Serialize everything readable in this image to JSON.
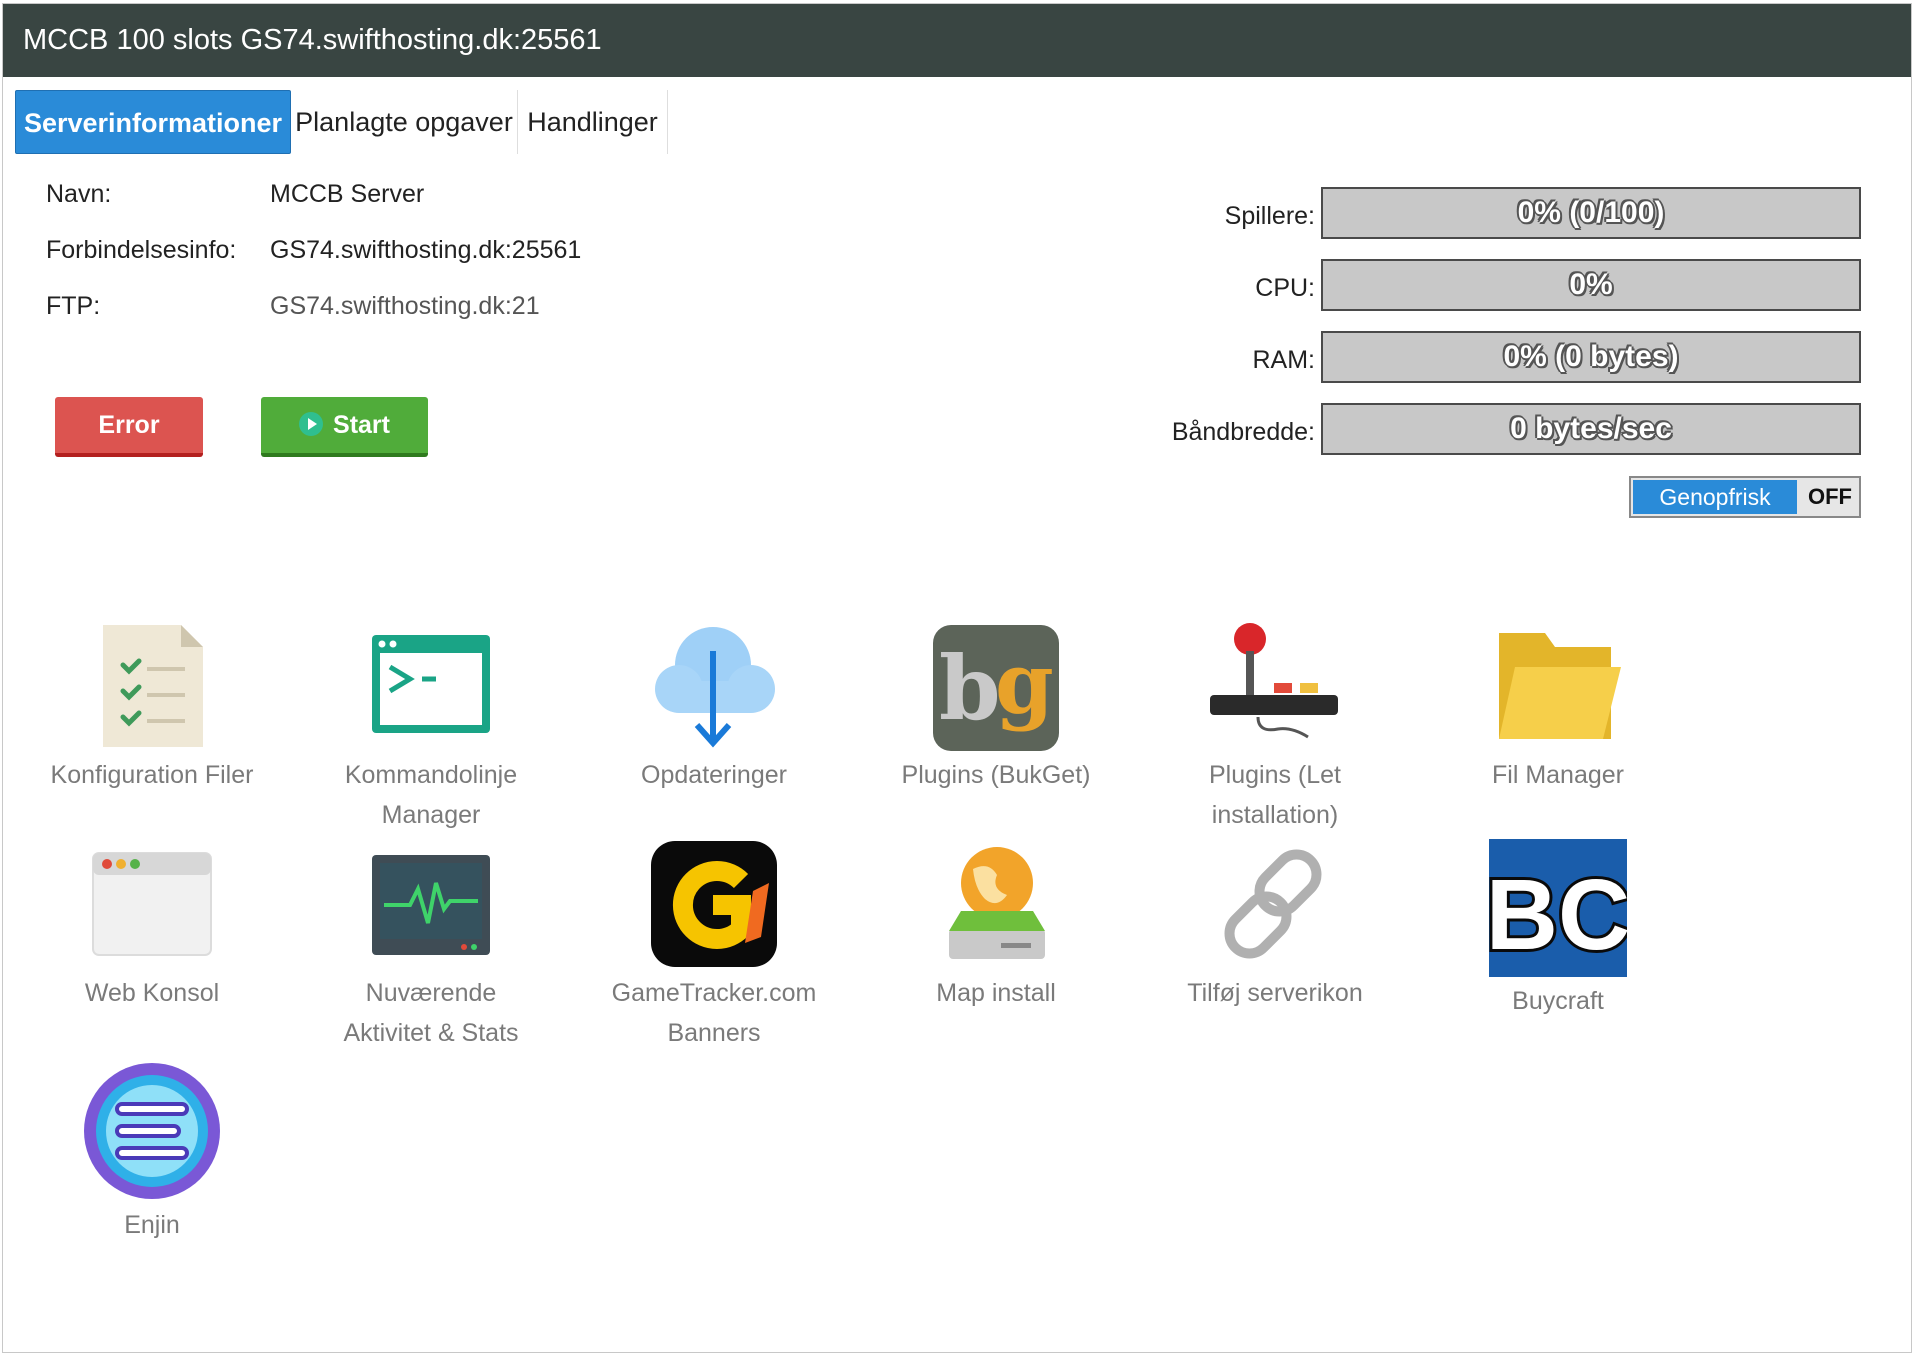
{
  "window": {
    "title": "MCCB 100 slots GS74.swifthosting.dk:25561"
  },
  "tabs": [
    {
      "label": "Serverinformationer",
      "active": true
    },
    {
      "label": "Planlagte opgaver",
      "active": false
    },
    {
      "label": "Handlinger",
      "active": false
    }
  ],
  "info": {
    "name_label": "Navn:",
    "name_value": "MCCB Server",
    "conn_label": "Forbindelsesinfo:",
    "conn_value": "GS74.swifthosting.dk:25561",
    "ftp_label": "FTP:",
    "ftp_value": "GS74.swifthosting.dk:21"
  },
  "buttons": {
    "error": "Error",
    "start": "Start"
  },
  "stats": {
    "players_label": "Spillere:",
    "players_text": "0% (0/100)",
    "players_fraction": 0,
    "cpu_label": "CPU:",
    "cpu_text": "0%",
    "cpu_fraction": 0,
    "ram_label": "RAM:",
    "ram_text": "0% (0 bytes)",
    "ram_fraction": 0,
    "bw_label": "Båndbredde:",
    "bw_text": "0 bytes/sec",
    "bw_fraction": 0
  },
  "refresh": {
    "label": "Genopfrisk",
    "state": "OFF"
  },
  "tiles": [
    {
      "label_1": "Konfiguration Filer",
      "label_2": "",
      "icon": "document-checklist-icon"
    },
    {
      "label_1": "Kommandolinje",
      "label_2": "Manager",
      "icon": "terminal-icon"
    },
    {
      "label_1": "Opdateringer",
      "label_2": "",
      "icon": "cloud-download-icon"
    },
    {
      "label_1": "Plugins (BukGet)",
      "label_2": "",
      "icon": "bukget-logo-icon"
    },
    {
      "label_1": "Plugins (Let",
      "label_2": "installation)",
      "icon": "joystick-icon"
    },
    {
      "label_1": "Fil Manager",
      "label_2": "",
      "icon": "folder-icon"
    },
    {
      "label_1": "Web Konsol",
      "label_2": "",
      "icon": "browser-window-icon"
    },
    {
      "label_1": "Nuværende",
      "label_2": "Aktivitet & Stats",
      "icon": "monitor-pulse-icon"
    },
    {
      "label_1": "GameTracker.com",
      "label_2": "Banners",
      "icon": "gametracker-logo-icon"
    },
    {
      "label_1": "Map install",
      "label_2": "",
      "icon": "globe-drive-icon"
    },
    {
      "label_1": "Tilføj serverikon",
      "label_2": "",
      "icon": "chain-link-icon"
    },
    {
      "label_1": "Buycraft",
      "label_2": "",
      "icon": "buycraft-logo-icon",
      "logo_text": "BC"
    },
    {
      "label_1": "Enjin",
      "label_2": "",
      "icon": "enjin-logo-icon"
    }
  ]
}
